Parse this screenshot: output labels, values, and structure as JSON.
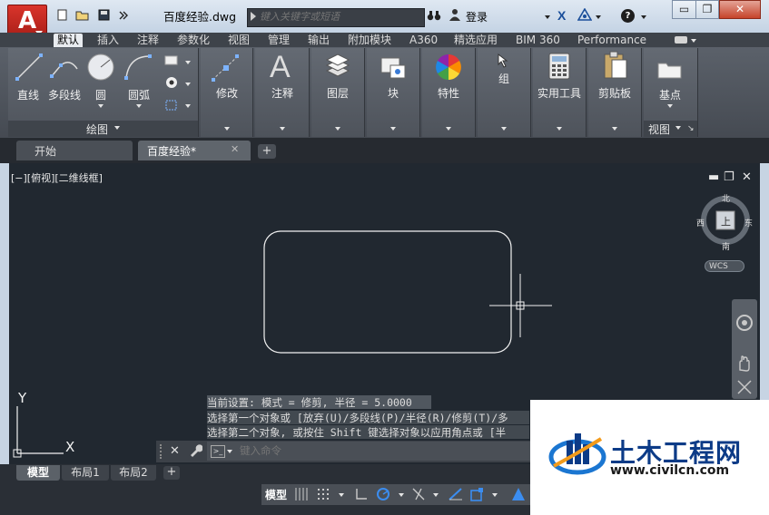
{
  "title_bar": {
    "app_logo": "A",
    "quick_access_icons": [
      "new-file-icon",
      "open-folder-icon",
      "save-icon",
      "more-icon"
    ],
    "doc_title": "百度经验.dwg",
    "search_placeholder": "键入关键字或短语",
    "login_label": "登录",
    "help_label": "?",
    "window_buttons": {
      "minimize": "▭",
      "restore": "❐",
      "close": "✕"
    }
  },
  "ribbon_tabs": [
    "默认",
    "插入",
    "注释",
    "参数化",
    "视图",
    "管理",
    "输出",
    "附加模块",
    "A360",
    "精选应用",
    "BIM 360",
    "Performance"
  ],
  "ribbon": {
    "draw_tools": [
      "直线",
      "多段线",
      "圆",
      "圆弧"
    ],
    "draw_panel_label": "绘图",
    "modify_label": "修改",
    "annotate_label": "注释",
    "layers_label": "图层",
    "block_label": "块",
    "properties_label": "特性",
    "group_label": "组",
    "utilities_label": "实用工具",
    "clipboard_label": "剪贴板",
    "basepoint_label": "基点",
    "view_panel_label": "视图"
  },
  "doc_tabs": {
    "start_label": "开始",
    "doc_label": "百度经验*",
    "close_icon": "✕",
    "add_label": "+"
  },
  "viewport": {
    "label": "[−][俯视][二维线框]",
    "controls": [
      "▬",
      "❐",
      "✕"
    ],
    "viewcube": {
      "north": "北",
      "south": "南",
      "east": "东",
      "west": "西",
      "top": "上"
    },
    "wcs_label": "WCS",
    "ucs_x": "X",
    "ucs_y": "Y"
  },
  "command_history": [
    "当前设置: 模式 = 修剪, 半径 = 5.0000",
    "选择第一个对象或 [放弃(U)/多段线(P)/半径(R)/修剪(T)/多",
    "选择第二个对象, 或按住 Shift 键选择对象以应用角点或 [半"
  ],
  "command_line": {
    "placeholder": "键入命令",
    "close_icon": "✕",
    "wrench_icon": "🔧"
  },
  "layout_tabs": [
    "模型",
    "布局1",
    "布局2"
  ],
  "layout_add": "+",
  "status_bar": {
    "model_label": "模型"
  },
  "watermark": {
    "title": "土木工程网",
    "url": "www.civilcn.com"
  },
  "colors": {
    "accent_red": "#c8231a",
    "viewport_bg": "#212830",
    "ribbon_bg": "#4e535b",
    "watermark_blue": "#0c3b87"
  }
}
